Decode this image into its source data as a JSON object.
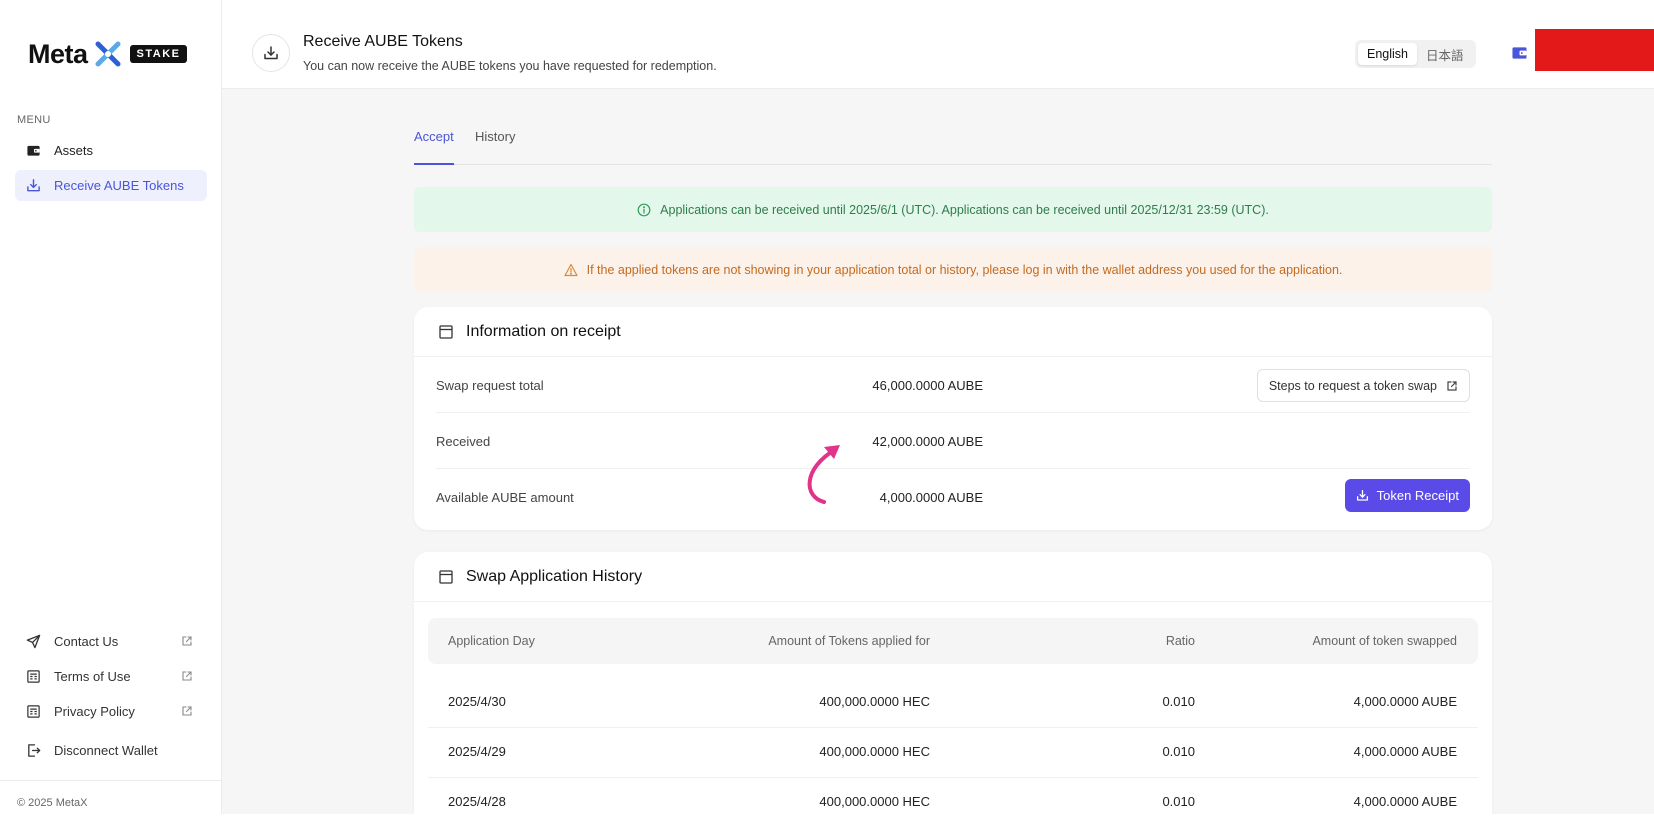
{
  "brand": {
    "name": "Meta",
    "badge": "STAKE"
  },
  "sidebar": {
    "menu_heading": "MENU",
    "items": [
      {
        "label": "Assets",
        "icon": "wallet-icon"
      },
      {
        "label": "Receive AUBE Tokens",
        "icon": "download-icon",
        "active": true
      }
    ],
    "bottom_items": [
      {
        "label": "Contact Us",
        "icon": "send-icon",
        "external": true
      },
      {
        "label": "Terms of Use",
        "icon": "document-icon",
        "external": true
      },
      {
        "label": "Privacy Policy",
        "icon": "document-icon",
        "external": true
      },
      {
        "label": "Disconnect Wallet",
        "icon": "logout-icon",
        "external": false
      }
    ],
    "copyright": "© 2025 MetaX"
  },
  "header": {
    "title": "Receive AUBE Tokens",
    "subtitle": "You can now receive the AUBE tokens you have requested for redemption.",
    "languages": [
      "English",
      "日本語"
    ],
    "active_language": "English"
  },
  "tabs": [
    {
      "label": "Accept",
      "active": true
    },
    {
      "label": "History",
      "active": false
    }
  ],
  "alerts": {
    "info": "Applications can be received until 2025/6/1 (UTC). Applications can be received until 2025/12/31 23:59 (UTC).",
    "warning": "If the applied tokens are not showing in your application total or history, please log in with the wallet address you used for the application."
  },
  "receipt": {
    "title": "Information on receipt",
    "rows": [
      {
        "label": "Swap request total",
        "value": "46,000.0000 AUBE"
      },
      {
        "label": "Received",
        "value": "42,000.0000 AUBE"
      },
      {
        "label": "Available AUBE amount",
        "value": "4,000.0000 AUBE"
      }
    ],
    "steps_button": "Steps to request a token swap",
    "receipt_button": "Token Receipt"
  },
  "history": {
    "title": "Swap Application History",
    "columns": [
      "Application Day",
      "Amount of Tokens applied for",
      "Ratio",
      "Amount of token swapped"
    ],
    "rows": [
      [
        "2025/4/30",
        "400,000.0000 HEC",
        "0.010",
        "4,000.0000 AUBE"
      ],
      [
        "2025/4/29",
        "400,000.0000 HEC",
        "0.010",
        "4,000.0000 AUBE"
      ],
      [
        "2025/4/28",
        "400,000.0000 HEC",
        "0.010",
        "4,000.0000 AUBE"
      ]
    ]
  },
  "colors": {
    "accent": "#4a55d9",
    "button": "#5a4be8",
    "annotation_arrow": "#e0338a",
    "red_block": "#e31818"
  }
}
